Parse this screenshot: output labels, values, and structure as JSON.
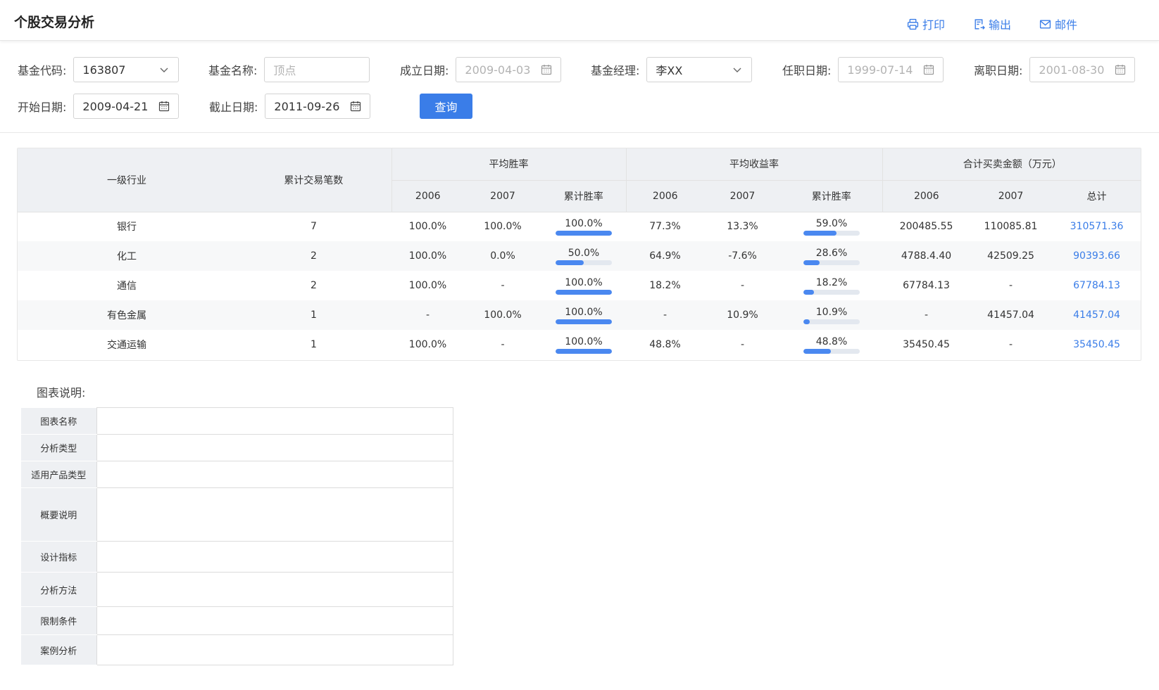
{
  "header": {
    "title": "个股交易分析",
    "actions": [
      {
        "label": "打印",
        "icon": "printer-icon"
      },
      {
        "label": "输出",
        "icon": "export-icon"
      },
      {
        "label": "邮件",
        "icon": "mail-icon"
      }
    ]
  },
  "filters": {
    "fund_code": {
      "label": "基金代码:",
      "value": "163807"
    },
    "fund_name": {
      "label": "基金名称:",
      "placeholder": "顶点"
    },
    "established_date": {
      "label": "成立日期:",
      "value": "2009-04-03"
    },
    "fund_manager": {
      "label": "基金经理:",
      "value": "李XX"
    },
    "appointment_date": {
      "label": "任职日期:",
      "value": "1999-07-14"
    },
    "departure_date": {
      "label": "离职日期:",
      "value": "2001-08-30"
    },
    "start_date": {
      "label": "开始日期:",
      "value": "2009-04-21"
    },
    "end_date": {
      "label": "截止日期:",
      "value": "2011-09-26"
    },
    "query_label": "查询"
  },
  "table": {
    "headers": {
      "industry": "一级行业",
      "trades": "累计交易笔数",
      "avg_win_rate": "平均胜率",
      "avg_return": "平均收益率",
      "total_amount": "合计买卖金额（万元）",
      "y2006": "2006",
      "y2007": "2007",
      "cum_win_rate": "累计胜率",
      "total": "总计"
    },
    "rows": [
      {
        "industry": "银行",
        "trades": "7",
        "win2006": "100.0%",
        "win2007": "100.0%",
        "win_cum": "100.0%",
        "win_cum_value": 1.0,
        "ret2006": "77.3%",
        "ret2007": "13.3%",
        "ret_cum": "59.0%",
        "ret_cum_value": 0.59,
        "amt2006": "200485.55",
        "amt2007": "110085.81",
        "amt_total": "310571.36"
      },
      {
        "industry": "化工",
        "trades": "2",
        "win2006": "100.0%",
        "win2007": "0.0%",
        "win_cum": "50.0%",
        "win_cum_value": 0.5,
        "ret2006": "64.9%",
        "ret2007": "-7.6%",
        "ret_cum": "28.6%",
        "ret_cum_value": 0.286,
        "amt2006": "4788.4.40",
        "amt2007": "42509.25",
        "amt_total": "90393.66"
      },
      {
        "industry": "通信",
        "trades": "2",
        "win2006": "100.0%",
        "win2007": "-",
        "win_cum": "100.0%",
        "win_cum_value": 1.0,
        "ret2006": "18.2%",
        "ret2007": "-",
        "ret_cum": "18.2%",
        "ret_cum_value": 0.182,
        "amt2006": "67784.13",
        "amt2007": "-",
        "amt_total": "67784.13"
      },
      {
        "industry": "有色金属",
        "trades": "1",
        "win2006": "-",
        "win2007": "100.0%",
        "win_cum": "100.0%",
        "win_cum_value": 1.0,
        "ret2006": "-",
        "ret2007": "10.9%",
        "ret_cum": "10.9%",
        "ret_cum_value": 0.109,
        "amt2006": "-",
        "amt2007": "41457.04",
        "amt_total": "41457.04"
      },
      {
        "industry": "交通运输",
        "trades": "1",
        "win2006": "100.0%",
        "win2007": "-",
        "win_cum": "100.0%",
        "win_cum_value": 1.0,
        "ret2006": "48.8%",
        "ret2007": "-",
        "ret_cum": "48.8%",
        "ret_cum_value": 0.488,
        "amt2006": "35450.45",
        "amt2007": "-",
        "amt_total": "35450.45"
      }
    ]
  },
  "chart_desc": {
    "title": "图表说明:",
    "rows": [
      {
        "label": "图表名称"
      },
      {
        "label": "分析类型"
      },
      {
        "label": "适用产品类型"
      },
      {
        "label": "概要说明"
      },
      {
        "label": "设计指标"
      },
      {
        "label": "分析方法"
      },
      {
        "label": "限制条件"
      },
      {
        "label": "案例分析"
      }
    ]
  },
  "colors": {
    "accent": "#3a7de8",
    "bar_fill": "#4a88f0",
    "bar_track": "#e3e8ef",
    "header_bg": "#eef0f3"
  }
}
